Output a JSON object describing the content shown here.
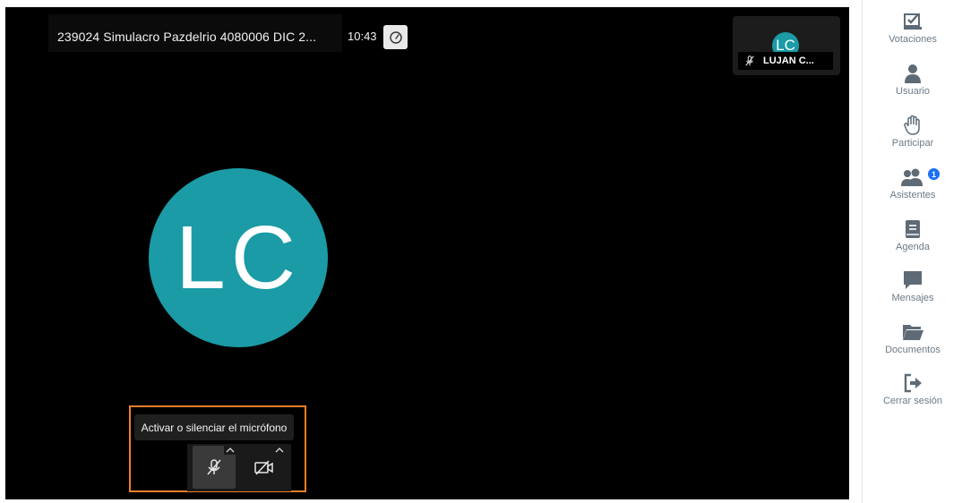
{
  "meeting": {
    "title": "239024 Simulacro Pazdelrio 4080006 DIC 2...",
    "time": "10:43"
  },
  "participant_thumb": {
    "initials": "LC",
    "name": "LUJAN C..."
  },
  "main_avatar": {
    "initials": "LC"
  },
  "controls": {
    "mic_tooltip": "Activar o silenciar el micrófono"
  },
  "sidebar": {
    "items": [
      {
        "label": "Votaciones",
        "icon": "checkbox-icon"
      },
      {
        "label": "Usuario",
        "icon": "user-icon"
      },
      {
        "label": "Participar",
        "icon": "hand-icon"
      },
      {
        "label": "Asistentes",
        "icon": "users-icon",
        "badge": "1"
      },
      {
        "label": "Agenda",
        "icon": "book-icon"
      },
      {
        "label": "Mensajes",
        "icon": "message-icon"
      },
      {
        "label": "Documentos",
        "icon": "folder-icon"
      },
      {
        "label": "Cerrar sesión",
        "icon": "logout-icon"
      }
    ]
  },
  "colors": {
    "avatar": "#1a9ba6",
    "highlight": "#f07f2a",
    "sidebar_text": "#6c7a86",
    "badge": "#1b6ef3"
  }
}
